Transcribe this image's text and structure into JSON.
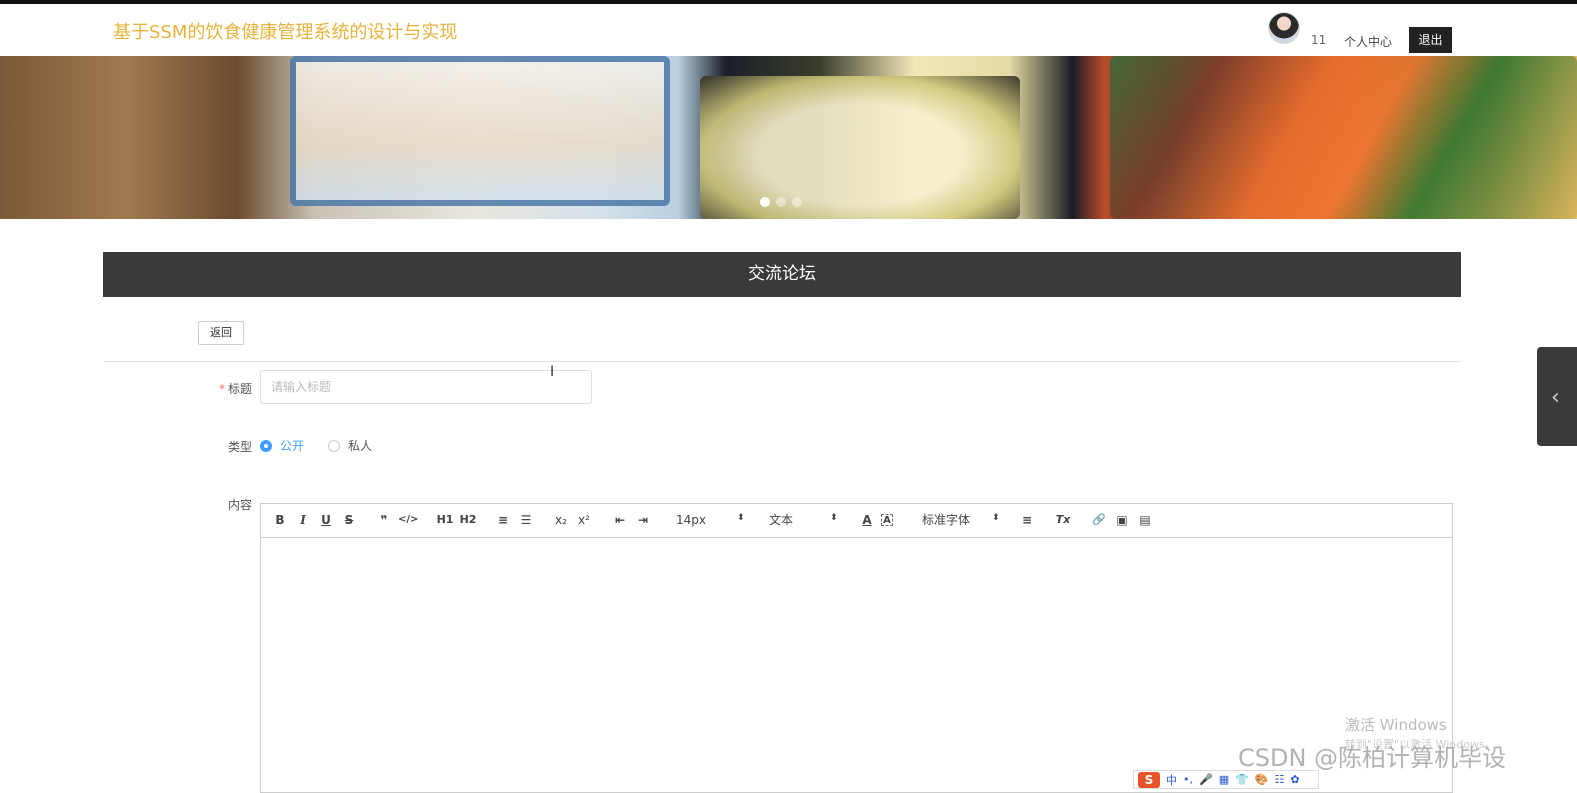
{
  "header": {
    "site_title": "基于SSM的饮食健康管理系统的设计与实现",
    "username": "11",
    "profile_link": "个人中心",
    "logout_label": "退出"
  },
  "banner": {
    "slides": 3,
    "active_slide": 1
  },
  "section": {
    "title": "交流论坛"
  },
  "form": {
    "back_label": "返回",
    "title_label": "标题",
    "title_placeholder": "请输入标题",
    "title_value": "",
    "type_label": "类型",
    "type_options": [
      "公开",
      "私人"
    ],
    "type_selected": "公开",
    "content_label": "内容"
  },
  "editor": {
    "toolbar": {
      "bold": "B",
      "italic": "I",
      "underline": "U",
      "strike": "S",
      "quote": "❞",
      "code": "</>",
      "h1": "H1",
      "h2": "H2",
      "ordered_list": "≡",
      "bullet_list": "☰",
      "subscript": "x₂",
      "superscript": "x²",
      "outdent": "⇤",
      "indent": "⇥",
      "size": "14px",
      "format": "文本",
      "font_color": "A",
      "background": "A",
      "font": "标准字体",
      "align": "≡",
      "clean": "Tx",
      "link": "🔗",
      "image": "▣",
      "video": "▤"
    }
  },
  "watermarks": {
    "windows_title": "激活 Windows",
    "windows_sub": "转到\"设置\"以激活 Windows。",
    "csdn": "CSDN @陈柏计算机毕设"
  },
  "ime": {
    "logo": "S",
    "items": [
      "中",
      "•,",
      "🎤",
      "▦",
      "👕",
      "🎨",
      "☷",
      "✿"
    ]
  }
}
